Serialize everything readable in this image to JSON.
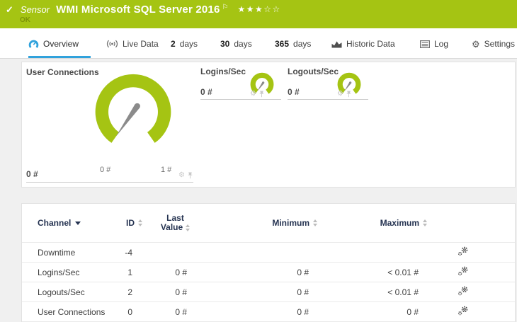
{
  "colors": {
    "status_green": "#a5c413",
    "accent_blue": "#31a2dc",
    "table_header_text": "#253351"
  },
  "header": {
    "check_glyph": "✓",
    "type_label": "Sensor",
    "title": "WMI Microsoft SQL Server 2016",
    "flag_glyph": "⚐",
    "rating_stars": "★★★☆☆",
    "status": "OK"
  },
  "tabs": {
    "overview": {
      "label": "Overview"
    },
    "live_data": {
      "label": "Live Data"
    },
    "days2": {
      "number": "2",
      "label": "days"
    },
    "days30": {
      "number": "30",
      "label": "days"
    },
    "days365": {
      "number": "365",
      "label": "days"
    },
    "historic": {
      "label": "Historic Data"
    },
    "log": {
      "label": "Log"
    },
    "settings": {
      "label": "Settings",
      "gear_glyph": "⚙"
    }
  },
  "gauges": {
    "gear_glyph": "⚙",
    "user_connections": {
      "title": "User Connections",
      "value": "0 #",
      "scale_min": "0 #",
      "scale_max": "1 #",
      "numeric": {
        "min": 0,
        "max": 1,
        "value": 0,
        "unit": "#"
      }
    },
    "logins": {
      "title": "Logins/Sec",
      "value": "0 #",
      "numeric": {
        "value": 0,
        "unit": "#"
      }
    },
    "logouts": {
      "title": "Logouts/Sec",
      "value": "0 #",
      "numeric": {
        "value": 0,
        "unit": "#"
      }
    }
  },
  "table": {
    "headers": {
      "channel": "Channel",
      "id": "ID",
      "last_line1": "Last",
      "last_line2": "Value",
      "minimum": "Minimum",
      "maximum": "Maximum"
    },
    "rows": [
      {
        "channel": "Downtime",
        "id": "-4",
        "last": "",
        "min": "",
        "max": ""
      },
      {
        "channel": "Logins/Sec",
        "id": "1",
        "last": "0 #",
        "min": "0 #",
        "max": "< 0.01 #"
      },
      {
        "channel": "Logouts/Sec",
        "id": "2",
        "last": "0 #",
        "min": "0 #",
        "max": "< 0.01 #"
      },
      {
        "channel": "User Connections",
        "id": "0",
        "last": "0 #",
        "min": "0 #",
        "max": "0 #"
      }
    ]
  }
}
